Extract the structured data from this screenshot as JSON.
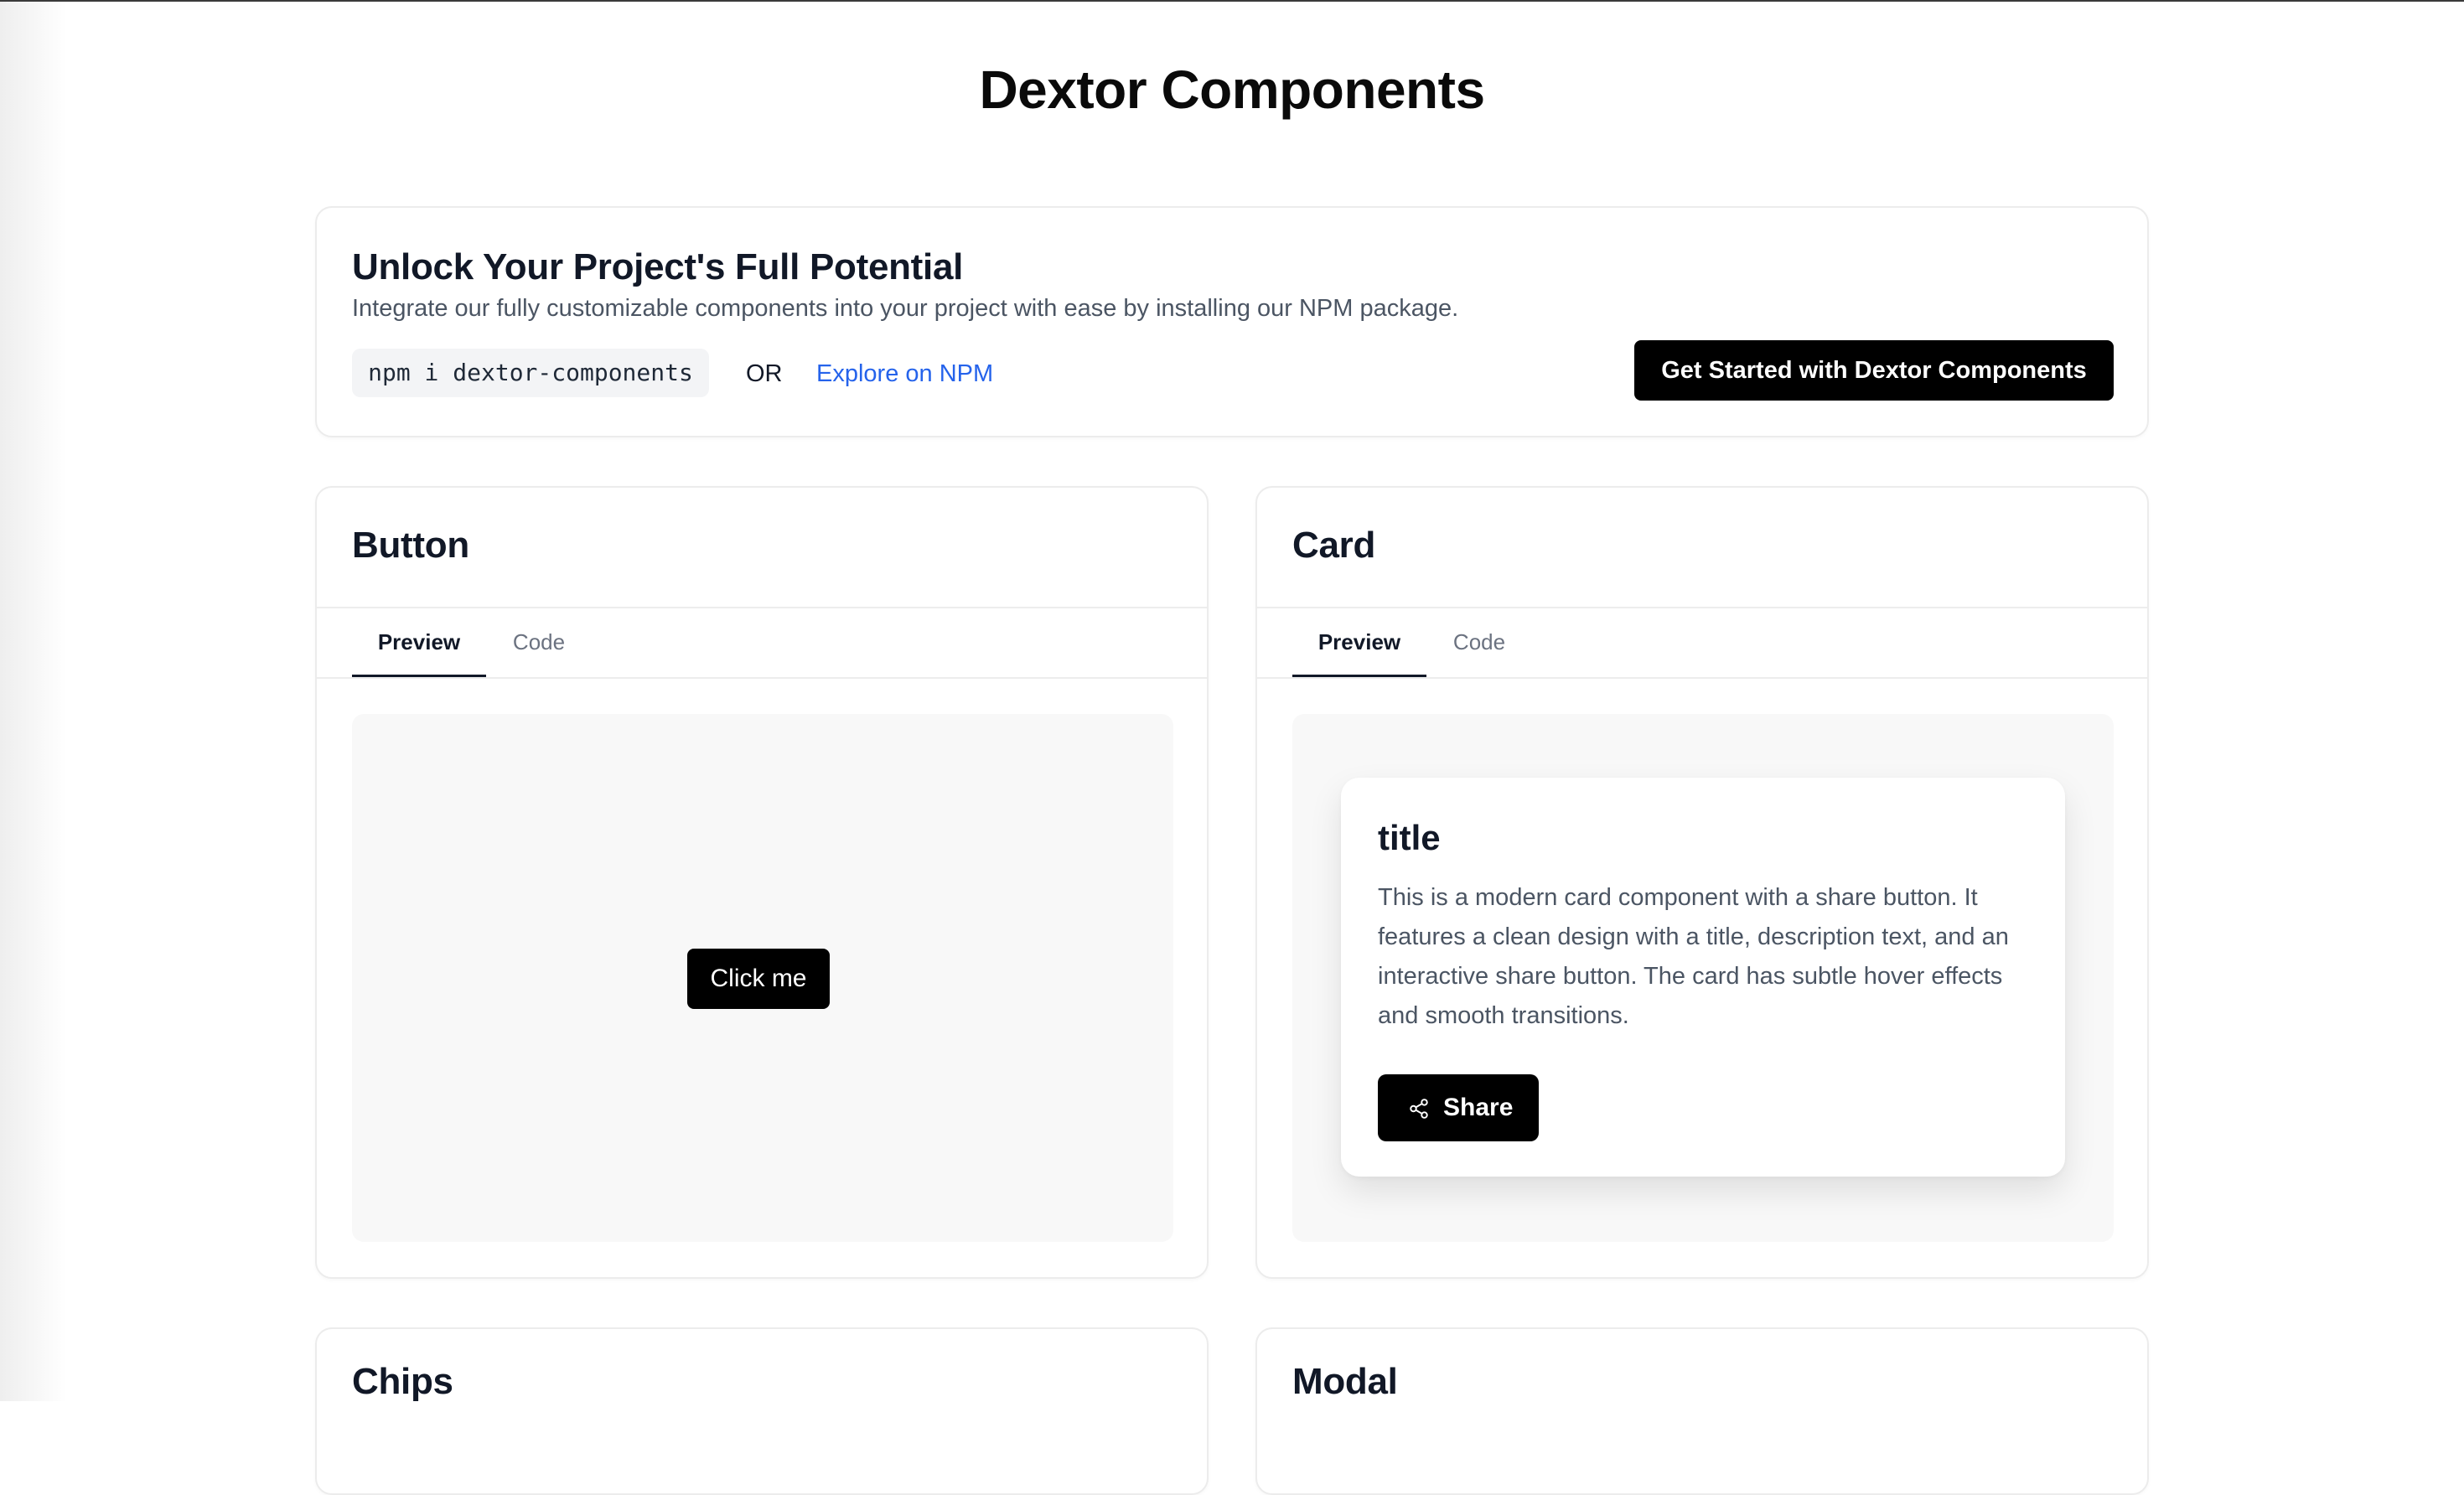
{
  "page": {
    "title": "Dextor Components"
  },
  "hero": {
    "heading": "Unlock Your Project's Full Potential",
    "description": "Integrate our fully customizable components into your project with ease by installing our NPM package.",
    "install_command": "npm i dextor-components",
    "or_label": "OR",
    "npm_link": "Explore on NPM",
    "cta_label": "Get Started with Dextor Components"
  },
  "components": {
    "button": {
      "title": "Button",
      "tabs": [
        {
          "label": "Preview",
          "active": true
        },
        {
          "label": "Code",
          "active": false
        }
      ],
      "demo_label": "Click me"
    },
    "card": {
      "title": "Card",
      "tabs": [
        {
          "label": "Preview",
          "active": true
        },
        {
          "label": "Code",
          "active": false
        }
      ],
      "demo": {
        "title": "title",
        "text": "This is a modern card component with a share button. It features a clean design with a title, description text, and an interactive share button. The card has subtle hover effects and smooth transitions.",
        "share_label": "Share",
        "share_icon": "share-icon"
      }
    },
    "chips": {
      "title": "Chips"
    },
    "modal": {
      "title": "Modal"
    }
  },
  "colors": {
    "primary": "#000000",
    "link": "#2563eb",
    "muted_text": "#4b5563",
    "preview_bg": "#f8f8f8",
    "border": "#ececec"
  }
}
